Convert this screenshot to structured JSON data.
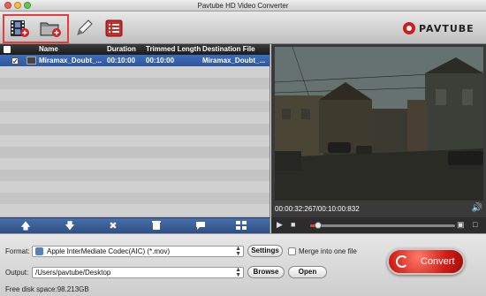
{
  "window": {
    "title": "Pavtube HD Video Converter"
  },
  "toolbar": {
    "buttons": [
      {
        "name": "add-video",
        "icon": "film-add-icon"
      },
      {
        "name": "add-folder",
        "icon": "folder-add-icon"
      },
      {
        "name": "edit",
        "icon": "pencil-icon"
      },
      {
        "name": "task-list",
        "icon": "list-icon"
      }
    ],
    "brand": "PAVTUBE"
  },
  "file_list": {
    "columns": [
      "Name",
      "Duration",
      "Trimmed Length",
      "Destination File"
    ],
    "rows": [
      {
        "checked": true,
        "name": "Miramax_Doubt_...",
        "duration": "00:10:00",
        "trimmed": "00:10:00",
        "destination": "Miramax_Doubt_..."
      }
    ],
    "bottom_icons": [
      "up-arrow-icon",
      "down-arrow-icon",
      "remove-icon",
      "trash-icon",
      "comment-icon",
      "merge-icon"
    ]
  },
  "preview": {
    "timecode": "00:00:32:267/00:10:00:832",
    "progress": 0.053
  },
  "output": {
    "format_label": "Format:",
    "format_value": "Apple InterMediate Codec(AIC) (*.mov)",
    "settings_label": "Settings",
    "merge_label": "Merge into one file",
    "merge_checked": false,
    "output_label": "Output:",
    "output_value": "/Users/pavtube/Desktop",
    "browse_label": "Browse",
    "open_label": "Open",
    "free_space": "Free disk space:98.213GB",
    "convert_label": "Convert"
  },
  "colors": {
    "selected_row": "#2e57a0",
    "convert_red": "#d11c14",
    "highlight": "#e53c3c"
  }
}
